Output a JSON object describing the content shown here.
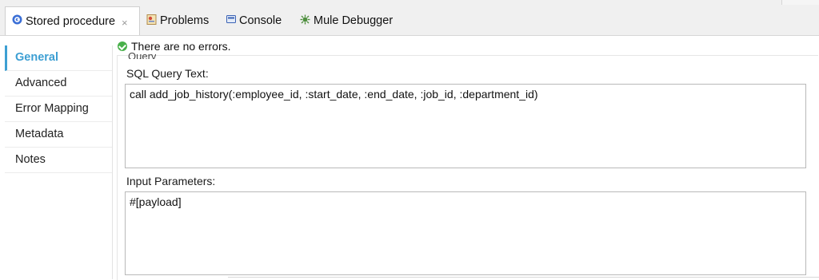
{
  "tabs": [
    {
      "label": "Stored procedure",
      "icon": "stored-procedure-icon",
      "active": true,
      "close": "×"
    },
    {
      "label": "Problems",
      "icon": "problems-icon"
    },
    {
      "label": "Console",
      "icon": "console-icon"
    },
    {
      "label": "Mule Debugger",
      "icon": "mule-debugger-icon"
    }
  ],
  "status": {
    "text": "There are no errors.",
    "icon": "check-circle-icon"
  },
  "nav": {
    "items": [
      "General",
      "Advanced",
      "Error Mapping",
      "Metadata",
      "Notes"
    ],
    "selected": "General"
  },
  "query": {
    "group_label": "Query",
    "sql_label": "SQL Query Text:",
    "sql_value": "call add_job_history(:employee_id, :start_date, :end_date, :job_id, :department_id)",
    "input_label": "Input Parameters:",
    "input_value": "#[payload]"
  },
  "colors": {
    "accent": "#3d9fd3",
    "ok": "#48b04a",
    "tabbar": "#f0f0f0"
  }
}
